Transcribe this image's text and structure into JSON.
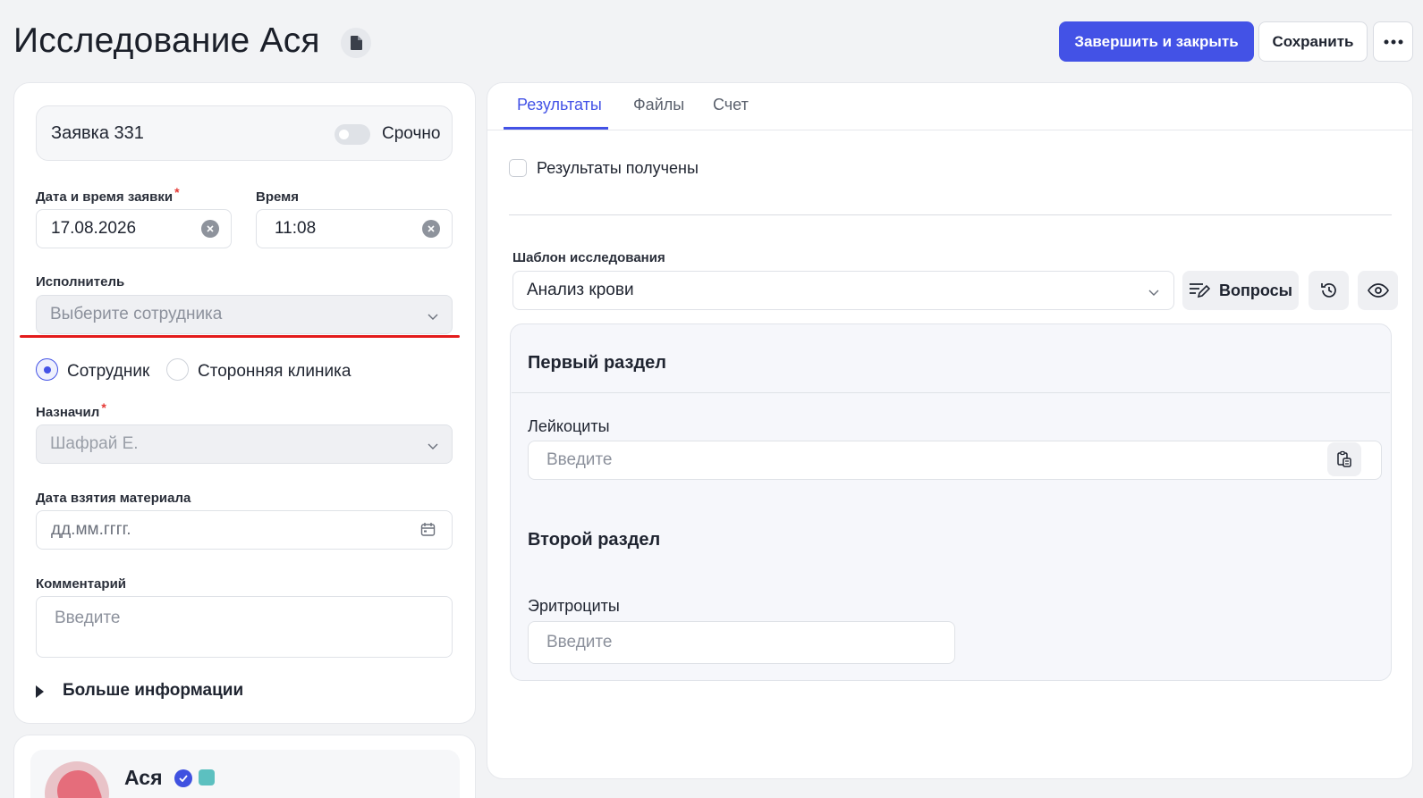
{
  "header": {
    "title": "Исследование Ася",
    "finish_label": "Завершить и закрыть",
    "save_label": "Сохранить"
  },
  "order": {
    "label": "Заявка 331",
    "urgent_label": "Срочно",
    "urgent_on": false
  },
  "form": {
    "date_label": "Дата и время заявки",
    "date_value": "17.08.2026",
    "time_label": "Время",
    "time_value": "11:08",
    "executor_label": "Исполнитель",
    "executor_placeholder": "Выберите сотрудника",
    "radio_employee": "Сотрудник",
    "radio_clinic": "Сторонняя клиника",
    "radio_selected": "Сотрудник",
    "assigned_label": "Назначил",
    "assigned_value": "Шафрай Е.",
    "material_date_label": "Дата взятия материала",
    "material_date_placeholder": "дд.мм.гггг.",
    "comment_label": "Комментарий",
    "comment_placeholder": "Введите",
    "more_info_label": "Больше информации",
    "required_mark": "*"
  },
  "patient": {
    "name": "Ася"
  },
  "tabs": [
    {
      "label": "Результаты",
      "active": true
    },
    {
      "label": "Файлы",
      "active": false
    },
    {
      "label": "Счет",
      "active": false
    }
  ],
  "results": {
    "received_label": "Результаты получены",
    "received_checked": false,
    "template_label": "Шаблон исследования",
    "template_value": "Анализ крови",
    "questions_label": "Вопросы",
    "sections": [
      {
        "title": "Первый раздел",
        "fields": [
          {
            "label": "Лейкоциты",
            "placeholder": "Введите"
          }
        ]
      },
      {
        "title": "Второй раздел",
        "fields": [
          {
            "label": "Эритроциты",
            "placeholder": "Введите"
          }
        ]
      }
    ]
  },
  "colors": {
    "accent": "#4352e6",
    "annotation": "#e31b1b",
    "required": "#e53935"
  },
  "icons": [
    "document-icon",
    "more-icon",
    "clear-icon",
    "chevron-down-icon",
    "calendar-icon",
    "edit-list-icon",
    "history-icon",
    "eye-icon",
    "copy-icon",
    "verified-icon",
    "medical-icon"
  ]
}
